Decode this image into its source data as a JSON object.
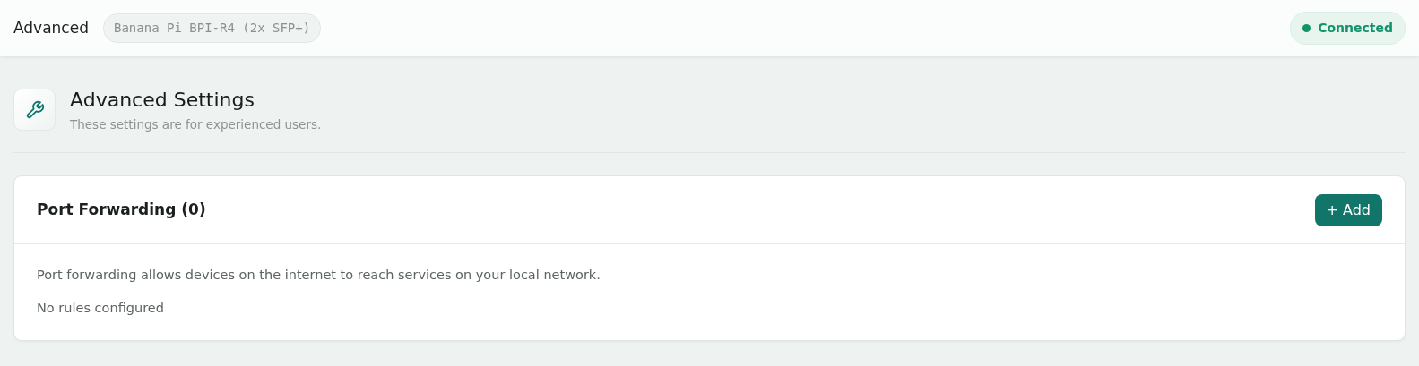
{
  "topbar": {
    "title": "Advanced",
    "device": "Banana Pi BPI-R4 (2x SFP+)",
    "status": {
      "label": "Connected",
      "connected": true
    }
  },
  "page_header": {
    "title": "Advanced Settings",
    "subtitle": "These settings are for experienced users."
  },
  "card": {
    "title": "Port Forwarding (0)",
    "add_button": "+ Add",
    "description": "Port forwarding allows devices on the internet to reach services on your local network.",
    "empty_text": "No rules configured"
  }
}
